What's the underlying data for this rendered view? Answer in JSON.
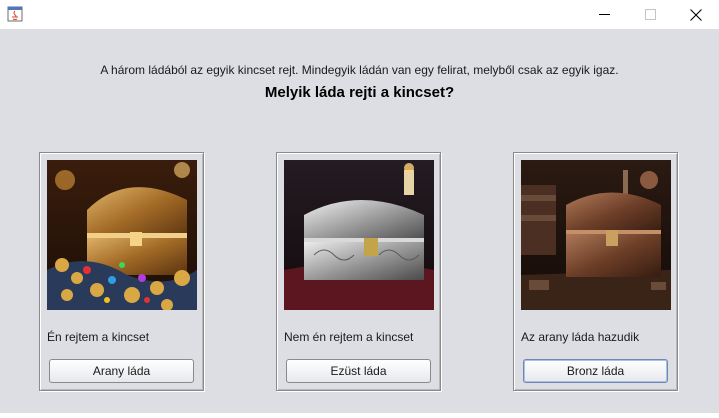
{
  "window": {
    "title": "",
    "controls": {
      "minimize_icon": "minimize-icon",
      "maximize_icon": "maximize-icon",
      "close_icon": "close-icon"
    }
  },
  "header": {
    "description": "A három ládából az egyik kincset rejt. Mindegyik ládán van egy felirat, melyből csak az egyik igaz.",
    "question": "Melyik láda rejti a kincset?"
  },
  "chests": [
    {
      "image": "gold-chest-image",
      "inscription": "Én rejtem a kincset",
      "button_label": "Arany láda"
    },
    {
      "image": "silver-chest-image",
      "inscription": "Nem én rejtem a kincset",
      "button_label": "Ezüst láda"
    },
    {
      "image": "bronze-chest-image",
      "inscription": "Az arany láda hazudik",
      "button_label": "Bronz láda"
    }
  ],
  "colors": {
    "background": "#dcdee3",
    "focus_border": "#6d89b3"
  }
}
